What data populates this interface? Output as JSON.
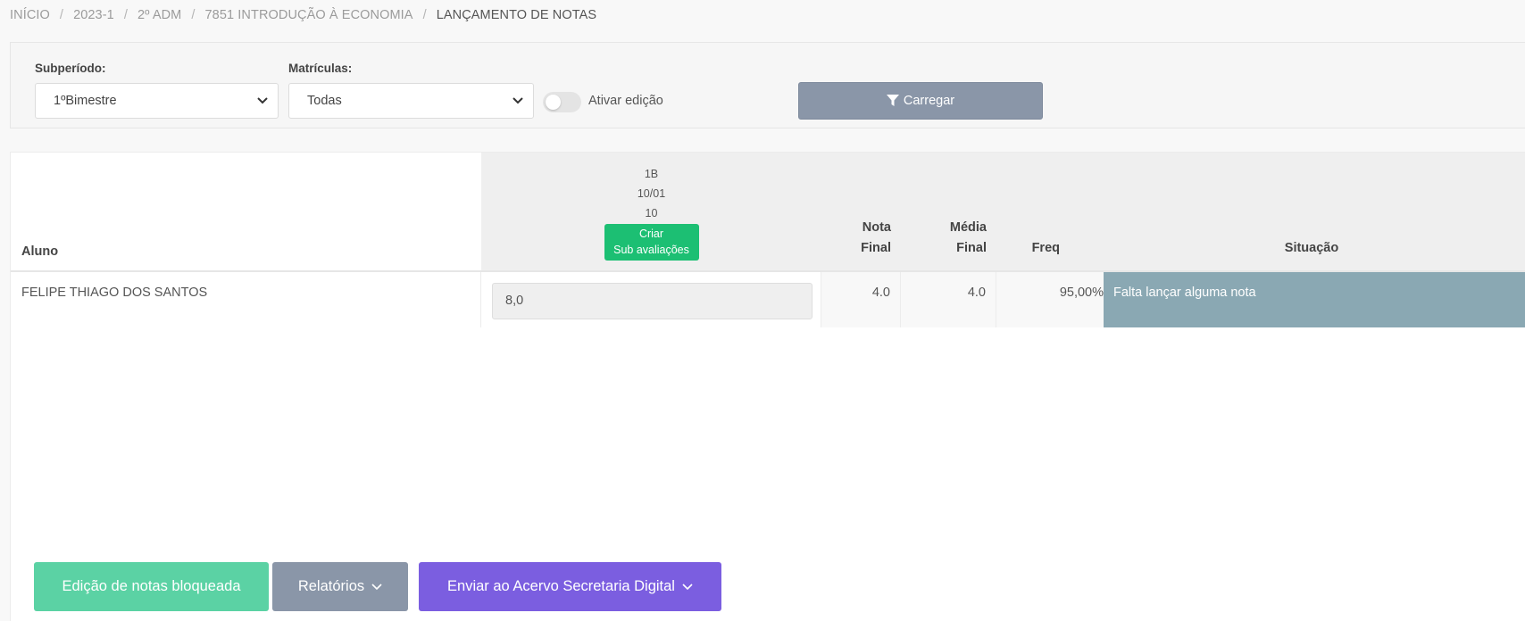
{
  "breadcrumb": {
    "items": [
      "INÍCIO",
      "2023-1",
      "2º ADM",
      "7851 INTRODUÇÃO À ECONOMIA"
    ],
    "active": "LANÇAMENTO DE NOTAS",
    "separator": "/"
  },
  "filters": {
    "subperiodo_label": "Subperíodo:",
    "subperiodo_value": "1ºBimestre",
    "matriculas_label": "Matrículas:",
    "matriculas_value": "Todas",
    "toggle_label": "Ativar edição",
    "toggle_on": false,
    "load_button": "Carregar"
  },
  "table": {
    "headers": {
      "aluno": "Aluno",
      "aval_code": "1B",
      "aval_date": "10/01",
      "aval_max": "10",
      "criar_line1": "Criar",
      "criar_line2": "Sub avaliações",
      "nota_line1": "Nota",
      "nota_line2": "Final",
      "media_line1": "Média",
      "media_line2": "Final",
      "freq": "Freq",
      "situacao": "Situação"
    },
    "rows": [
      {
        "aluno": "FELIPE THIAGO DOS SANTOS",
        "nota_aval": "8,0",
        "nota_final": "4.0",
        "media_final": "4.0",
        "freq": "95,00%",
        "situacao": "Falta lançar alguma nota"
      }
    ]
  },
  "actions": {
    "locked": "Edição de notas bloqueada",
    "relatorios": "Relatórios",
    "enviar": "Enviar ao Acervo Secretaria Digital"
  },
  "colors": {
    "green": "#1cbf73",
    "purple": "#7b5ee0",
    "gray_button": "#8a96a8",
    "status_pending": "#8aa8b3"
  }
}
